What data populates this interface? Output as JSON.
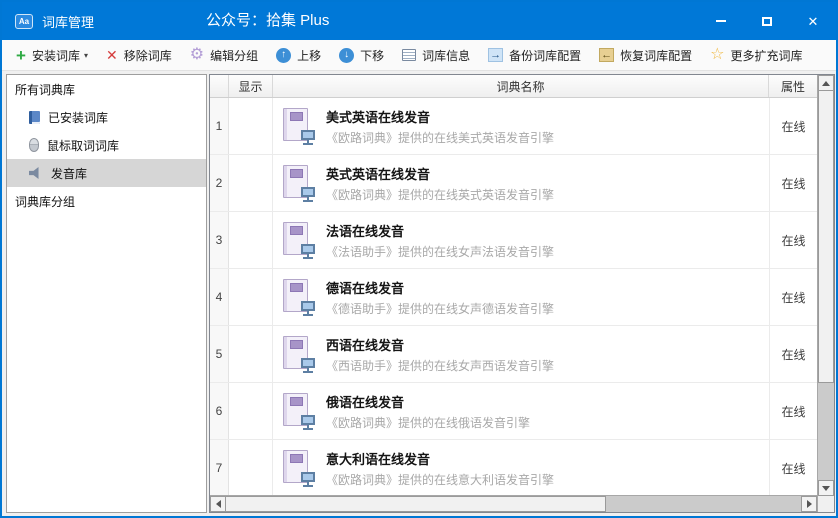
{
  "titlebar": {
    "app_badge": "Aa",
    "title": "词库管理",
    "center_title": "公众号：拾集 Plus"
  },
  "toolbar": {
    "buttons": [
      {
        "label": "安装词库",
        "icon": "plus-icon",
        "caret": "▾"
      },
      {
        "label": "移除词库",
        "icon": "remove-icon"
      },
      {
        "label": "编辑分组",
        "icon": "gear-icon"
      },
      {
        "label": "上移",
        "icon": "up-icon"
      },
      {
        "label": "下移",
        "icon": "down-icon"
      },
      {
        "label": "词库信息",
        "icon": "info-icon"
      },
      {
        "label": "备份词库配置",
        "icon": "backup-icon"
      },
      {
        "label": "恢复词库配置",
        "icon": "restore-icon"
      },
      {
        "label": "更多扩充词库",
        "icon": "star-icon"
      }
    ]
  },
  "sidebar": {
    "items": [
      {
        "label": "所有词典库",
        "icon": "",
        "level": 0,
        "selected": false
      },
      {
        "label": "已安装词库",
        "icon": "book-icon",
        "level": 1,
        "selected": false
      },
      {
        "label": "鼠标取词词库",
        "icon": "mouse-icon",
        "level": 1,
        "selected": false
      },
      {
        "label": "发音库",
        "icon": "speaker-icon",
        "level": 1,
        "selected": true
      },
      {
        "label": "词典库分组",
        "icon": "",
        "level": 0,
        "selected": false
      }
    ]
  },
  "table": {
    "headers": {
      "show": "显示",
      "name": "词典名称",
      "attr": "属性"
    },
    "rows": [
      {
        "num": "1",
        "title": "美式英语在线发音",
        "subtitle": "《欧路词典》提供的在线美式英语发音引擎",
        "attr": "在线"
      },
      {
        "num": "2",
        "title": "英式英语在线发音",
        "subtitle": "《欧路词典》提供的在线英式英语发音引擎",
        "attr": "在线"
      },
      {
        "num": "3",
        "title": "法语在线发音",
        "subtitle": "《法语助手》提供的在线女声法语发音引擎",
        "attr": "在线"
      },
      {
        "num": "4",
        "title": "德语在线发音",
        "subtitle": "《德语助手》提供的在线女声德语发音引擎",
        "attr": "在线"
      },
      {
        "num": "5",
        "title": "西语在线发音",
        "subtitle": "《西语助手》提供的在线女声西语发音引擎",
        "attr": "在线"
      },
      {
        "num": "6",
        "title": "俄语在线发音",
        "subtitle": "《欧路词典》提供的在线俄语发音引擎",
        "attr": "在线"
      },
      {
        "num": "7",
        "title": "意大利语在线发音",
        "subtitle": "《欧路词典》提供的在线意大利语发音引擎",
        "attr": "在线"
      }
    ]
  },
  "colors": {
    "titlebar_blue": "#0078d7",
    "selection_gray": "#d6d6d6",
    "dict_icon_purple": "#a794c8",
    "accent_green": "#2faa44",
    "accent_red": "#d53c3c",
    "star_yellow": "#f0b73d"
  }
}
